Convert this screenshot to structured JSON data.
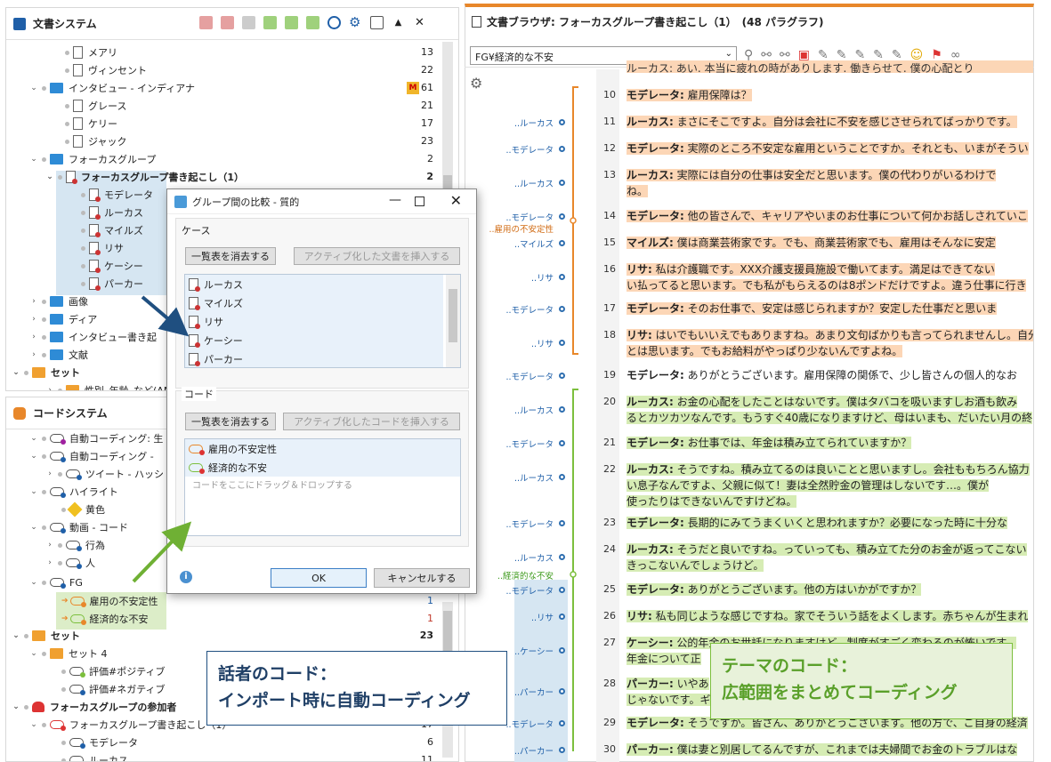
{
  "doc_system": {
    "title": "文書システム",
    "rows": [
      {
        "label": "メアリ",
        "count": "13"
      },
      {
        "label": "ヴィンセント",
        "count": "22"
      },
      {
        "label": "インタビュー - インディアナ",
        "count": "61",
        "badge": "M"
      },
      {
        "label": "グレース",
        "count": "21"
      },
      {
        "label": "ケリー",
        "count": "17"
      },
      {
        "label": "ジャック",
        "count": "23"
      },
      {
        "label": "フォーカスグループ",
        "count": "2"
      },
      {
        "label": "フォーカスグループ書き起こし（1）",
        "count": "2"
      },
      {
        "label": "モデレータ"
      },
      {
        "label": "ルーカス"
      },
      {
        "label": "マイルズ"
      },
      {
        "label": "リサ"
      },
      {
        "label": "ケーシー"
      },
      {
        "label": "パーカー"
      },
      {
        "label": "画像"
      },
      {
        "label": "ディア"
      },
      {
        "label": "インタビュー書き起"
      },
      {
        "label": "文献"
      },
      {
        "label": "セット"
      },
      {
        "label": "性別_年齢_など(AND"
      }
    ]
  },
  "code_system": {
    "title": "コードシステム",
    "rows": [
      {
        "label": "自動コーディング: 生"
      },
      {
        "label": "自動コーディング -"
      },
      {
        "label": "ツイート - ハッシ"
      },
      {
        "label": "ハイライト"
      },
      {
        "label": "黄色"
      },
      {
        "label": "動画 - コード"
      },
      {
        "label": "行為"
      },
      {
        "label": "人"
      },
      {
        "label": "FG"
      },
      {
        "label": "雇用の不安定性",
        "count": "1"
      },
      {
        "label": "経済的な不安",
        "count": "1"
      },
      {
        "label": "セット",
        "count": "23"
      },
      {
        "label": "セット 4"
      },
      {
        "label": "評価#ポジティブ"
      },
      {
        "label": "評価#ネガティブ"
      },
      {
        "label": "フォーカスグループの参加者"
      },
      {
        "label": "フォーカスグループ書き起こし（1）",
        "count": "17"
      },
      {
        "label": "モデレータ",
        "count": "6"
      },
      {
        "label": "ルーカス",
        "count": "11"
      }
    ]
  },
  "dialog": {
    "title": "グループ間の比較 - 質的",
    "cases_label": "ケース",
    "clear_cases": "一覧表を消去する",
    "insert_docs": "アクティブ化した文書を挿入する",
    "cases": [
      "ルーカス",
      "マイルズ",
      "リサ",
      "ケーシー",
      "パーカー"
    ],
    "codes_label": "コード",
    "clear_codes": "一覧表を消去する",
    "insert_codes": "アクティブ化したコードを挿入する",
    "codes": [
      "雇用の不安定性",
      "経済的な不安"
    ],
    "drop_hint": "コードをここにドラッグ＆ドロップする",
    "ok": "OK",
    "cancel": "キャンセルする"
  },
  "browser": {
    "title": "文書ブラウザ: フォーカスグループ書き起こし（1）　(48 パラグラフ)",
    "code_select": "FG¥経済的な不安",
    "top_partial": "ルーカス: あい. 本当に疲れの時がありします. 働きらせて. 僕の心配とり",
    "paragraphs": [
      {
        "n": "10",
        "spk": "",
        "sp": "モデレータ:",
        "t": " 雇用保障は？",
        "hl": "o"
      },
      {
        "n": "11",
        "spk": "..ルーカス",
        "sp": "ルーカス:",
        "t": " まさにそこですよ。自分は会社に不安を感じさせられてばっかりです。",
        "hl": "o"
      },
      {
        "n": "12",
        "spk": "..モデレータ",
        "sp": "モデレータ:",
        "t": " 実際のところ不安定な雇用ということですか。それとも、いまがそうい",
        "hl": "o"
      },
      {
        "n": "13",
        "spk": "..ルーカス",
        "sp": "ルーカス:",
        "t": " 実際には自分の仕事は安全だと思います。僕の代わりがいるわけで",
        "t2": "ね。",
        "hl": "o"
      },
      {
        "n": "14",
        "spk": "..モデレータ",
        "sp": "モデレータ:",
        "t": " 他の皆さんで、キャリアやいまのお仕事について何かお話しされていこ",
        "hl": "o"
      },
      {
        "n": "15",
        "spk": "..マイルズ",
        "sp": "マイルズ:",
        "t": " 僕は商業芸術家です。でも、商業芸術家でも、雇用はそんなに安定",
        "hl": "o"
      },
      {
        "n": "16",
        "spk": "..リサ",
        "sp": "リサ:",
        "t": " 私は介護職です。XXX介護支援員施設で働いてます。満足はできてない",
        "t2": "い払ってると思います。でも私がもらえるのは8ポンドだけですよ。違う仕事に行き",
        "hl": "o"
      },
      {
        "n": "17",
        "spk": "..モデレータ",
        "sp": "モデレータ:",
        "t": " そのお仕事で、安定は感じられますか？安定した仕事だと思いま",
        "hl": "o"
      },
      {
        "n": "18",
        "spk": "..リサ",
        "sp": "リサ:",
        "t": " はいでもいいえでもありますね。あまり文句ばかりも言ってられませんし。自分",
        "t2": "とは思います。でもお給料がやっぱり少ないんですよね。",
        "hl": "o"
      },
      {
        "n": "19",
        "spk": "..モデレータ",
        "sp": "モデレータ:",
        "t": " ありがとうございます。雇用保障の関係で、少し皆さんの個人的なお",
        "hl": ""
      },
      {
        "n": "20",
        "spk": "..ルーカス",
        "sp": "ルーカス:",
        "t": " お金の心配をしたことはないです。僕はタバコを吸いますしお酒も飲み",
        "t2": "るとカツカツなんです。もうすぐ40歳になりますけど、母はいまも、だいたい月の終",
        "hl": "g"
      },
      {
        "n": "21",
        "spk": "..モデレータ",
        "sp": "モデレータ:",
        "t": " お仕事では、年金は積み立てられていますか？",
        "hl": "g"
      },
      {
        "n": "22",
        "spk": "..ルーカス",
        "sp": "ルーカス:",
        "t": " そうですね。積み立てるのは良いことと思いますし。会社ももちろん協力",
        "t2": "い息子なんですよ、父親に似て！妻は全然貯金の管理はしないです…。僕が",
        "t3": "使ったりはできないんですけどね。",
        "hl": "g"
      },
      {
        "n": "23",
        "spk": "..モデレータ",
        "sp": "モデレータ:",
        "t": " 長期的にみてうまくいくと思われますか？必要になった時に十分な",
        "hl": "g"
      },
      {
        "n": "24",
        "spk": "..ルーカス",
        "sp": "ルーカス:",
        "t": " そうだと良いですね。っていっても、積み立てた分のお金が返ってこない",
        "t2": "きっこないんでしょうけど。",
        "hl": "g"
      },
      {
        "n": "25",
        "spk": "..モデレータ",
        "sp": "モデレータ:",
        "t": " ありがとうございます。他の方はいかがですか？",
        "hl": "g"
      },
      {
        "n": "26",
        "spk": "..リサ",
        "sp": "リサ:",
        "t": " 私も同じような感じですね。家でそういう話をよくします。赤ちゃんが生まれ",
        "hl": "g"
      },
      {
        "n": "27",
        "spk": "..ケーシー",
        "sp": "ケーシー:",
        "t": " 公的年金のお世話になりますけど、制度がすごく変わるのが怖いです。",
        "t2": "年金について正",
        "hl": "g"
      },
      {
        "n": "28",
        "spk": "..パーカー",
        "sp": "パーカー:",
        "t": " いやあ",
        "t2": "じゃないです。ギ",
        "hl": "g"
      },
      {
        "n": "29",
        "spk": "..モデレータ",
        "sp": "モデレータ:",
        "t": " そうですか。皆さん、ありがとうございます。他の方で、ご自身の経済",
        "hl": "g"
      },
      {
        "n": "30",
        "spk": "..パーカー",
        "sp": "パーカー:",
        "t": " 僕は妻と別居してるんですが、これまでは夫婦間でお金のトラブルはな",
        "hl": "g"
      }
    ],
    "code_labels": {
      "orange": "..雇用の不安定性",
      "green": "..経済的な不安"
    }
  },
  "callouts": {
    "speaker_line1": "話者のコード：",
    "speaker_line2": "インポート時に自動コーディング",
    "theme_line1": "テーマのコード：",
    "theme_line2": "広範囲をまとめてコーディング"
  },
  "colors": {
    "orange": "#e8872a",
    "green": "#7cbf3d",
    "blue": "#2f6fb0",
    "highlight_orange": "#fcd6b6",
    "highlight_green": "#d6ecb4"
  }
}
